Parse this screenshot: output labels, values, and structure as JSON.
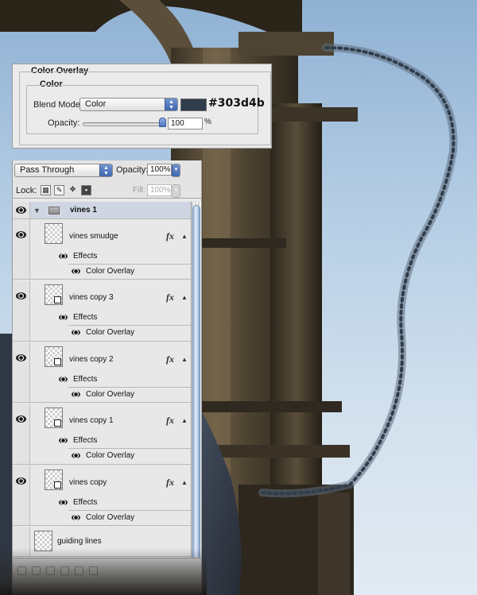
{
  "color_overlay": {
    "title": "Color Overlay",
    "group_label": "Color",
    "blend_mode_label": "Blend Mode:",
    "blend_mode_value": "Color",
    "color_hex": "#303d4b",
    "opacity_label": "Opacity:",
    "opacity_value": "100",
    "opacity_unit": "%",
    "opacity_slider_percent": 100
  },
  "layers_panel": {
    "blend_mode": "Pass Through",
    "opacity_label": "Opacity:",
    "opacity_value": "100%",
    "lock_label": "Lock:",
    "fill_label": "Fill:",
    "fill_value": "100%",
    "group_name": "vines 1",
    "effects_label": "Effects",
    "color_overlay_label": "Color Overlay",
    "fx_label": "fx",
    "layers": [
      {
        "name": "vines smudge"
      },
      {
        "name": "vines copy 3"
      },
      {
        "name": "vines copy 2"
      },
      {
        "name": "vines copy 1"
      },
      {
        "name": "vines copy"
      }
    ],
    "bottom_layer": "guiding lines"
  },
  "colors": {
    "overlay_swatch": "#303d4b",
    "panel_bg": "#e8e8e8",
    "group_row": "#cfd5e2"
  },
  "icons": [
    "eye-icon",
    "folder-icon",
    "fx-icon",
    "lock-transparency-icon",
    "lock-brush-icon",
    "lock-move-icon",
    "lock-all-icon",
    "chevron-up-icon"
  ]
}
